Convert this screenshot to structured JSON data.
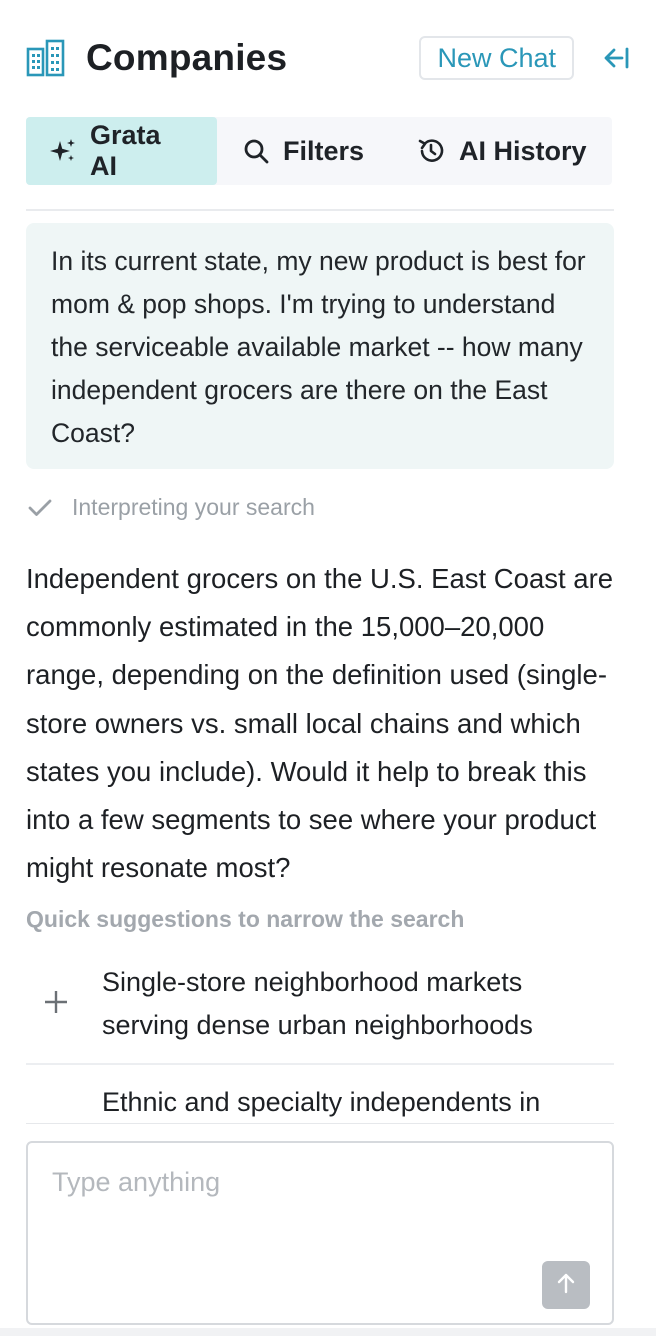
{
  "header": {
    "title": "Companies",
    "new_chat_label": "New Chat",
    "icons": [
      "buildings-icon",
      "collapse-panel-icon"
    ]
  },
  "tabs": [
    {
      "label": "Grata AI",
      "icon": "sparkle-icon",
      "active": true
    },
    {
      "label": "Filters",
      "icon": "search-icon",
      "active": false
    },
    {
      "label": "AI History",
      "icon": "history-icon",
      "active": false
    }
  ],
  "user_message": "In its current state, my new product is best for mom & pop shops. I'm trying to understand the serviceable available market -- how many independent grocers are there on the East Coast?",
  "status": {
    "label": "Interpreting your search",
    "icon": "check-icon"
  },
  "answer": "Independent grocers on the U.S. East Coast are commonly estimated in the 15,000–20,000 range, depending on the definition used (single-store owners vs. small local chains and which states you include). Would it help to break this into a few segments to see where your product might resonate most?",
  "quick_suggestions": {
    "heading": "Quick suggestions to narrow the search",
    "items": [
      {
        "label": "Single-store neighborhood markets serving dense urban neighborhoods",
        "icon": "plus-icon"
      },
      {
        "label": "Ethnic and specialty independents in",
        "icon": "plus-icon"
      }
    ]
  },
  "composer": {
    "placeholder": "Type anything",
    "send_icon": "arrow-up-icon"
  },
  "colors": {
    "accent": "#2a97b8",
    "active_tab_bg": "#cdeeee",
    "user_msg_bg": "#eff6f6",
    "muted_text": "#9aa0a6",
    "send_button_bg": "#b9bdc2"
  }
}
